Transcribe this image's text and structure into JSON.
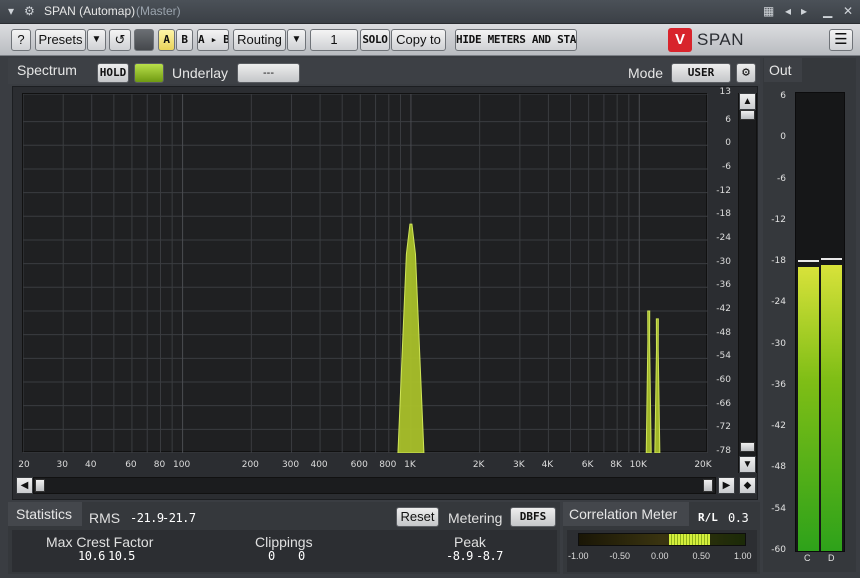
{
  "window": {
    "title": "SPAN (Automap)",
    "subtitle": "(Master)"
  },
  "toolbar": {
    "help": "?",
    "presets": "Presets",
    "ab_a": "A",
    "ab_b": "B",
    "a_to_b": "A ▸ B",
    "routing": "Routing",
    "channel": "1",
    "solo": "SOLO",
    "copy_to": "Copy to",
    "hide_meters": "HIDE METERS AND STATS",
    "brand": "SPAN"
  },
  "spectrum": {
    "title": "Spectrum",
    "hold": "HOLD",
    "underlay_label": "Underlay",
    "underlay_value": "---",
    "mode_label": "Mode",
    "mode_value": "USER",
    "db_ticks": [
      "13",
      "6",
      "0",
      "-6",
      "-12",
      "-18",
      "-24",
      "-30",
      "-36",
      "-42",
      "-48",
      "-54",
      "-60",
      "-66",
      "-72",
      "-78"
    ],
    "freq_ticks": [
      "20",
      "30",
      "40",
      "60",
      "80",
      "100",
      "200",
      "300",
      "400",
      "600",
      "800",
      "1K",
      "2K",
      "3K",
      "4K",
      "6K",
      "8K",
      "10K",
      "20K"
    ],
    "peaks": [
      {
        "freq_hz": 1000,
        "db": -20
      },
      {
        "freq_hz": 11000,
        "db": -42
      },
      {
        "freq_hz": 12000,
        "db": -44
      }
    ],
    "colors": {
      "fill": "#a9c02a",
      "line": "#d9f05a",
      "grid": "#3a3c40"
    }
  },
  "out": {
    "title": "Out",
    "ticks": [
      "6",
      "0",
      "-6",
      "-12",
      "-18",
      "-24",
      "-30",
      "-36",
      "-42",
      "-48",
      "-54",
      "-60"
    ],
    "channels": [
      "C",
      "D"
    ],
    "levels_db": [
      -18.5,
      -18.3
    ],
    "hold_db": [
      -17.5,
      -17.2
    ]
  },
  "statistics": {
    "title": "Statistics",
    "rms_label": "RMS",
    "rms_l": "-21.9",
    "rms_r": "-21.7",
    "reset": "Reset",
    "metering_label": "Metering",
    "metering_value": "DBFS",
    "crest_label": "Max Crest Factor",
    "crest_l": "10.6",
    "crest_r": "10.5",
    "clip_label": "Clippings",
    "clip_l": "0",
    "clip_r": "0",
    "peak_label": "Peak",
    "peak_l": "-8.9",
    "peak_r": "-8.7"
  },
  "correlation": {
    "title": "Correlation Meter",
    "rl_label": "R/L",
    "rl_value": "0.3",
    "scale": [
      "-1.00",
      "-0.50",
      "0.00",
      "0.50",
      "1.00"
    ],
    "value": 0.3
  }
}
